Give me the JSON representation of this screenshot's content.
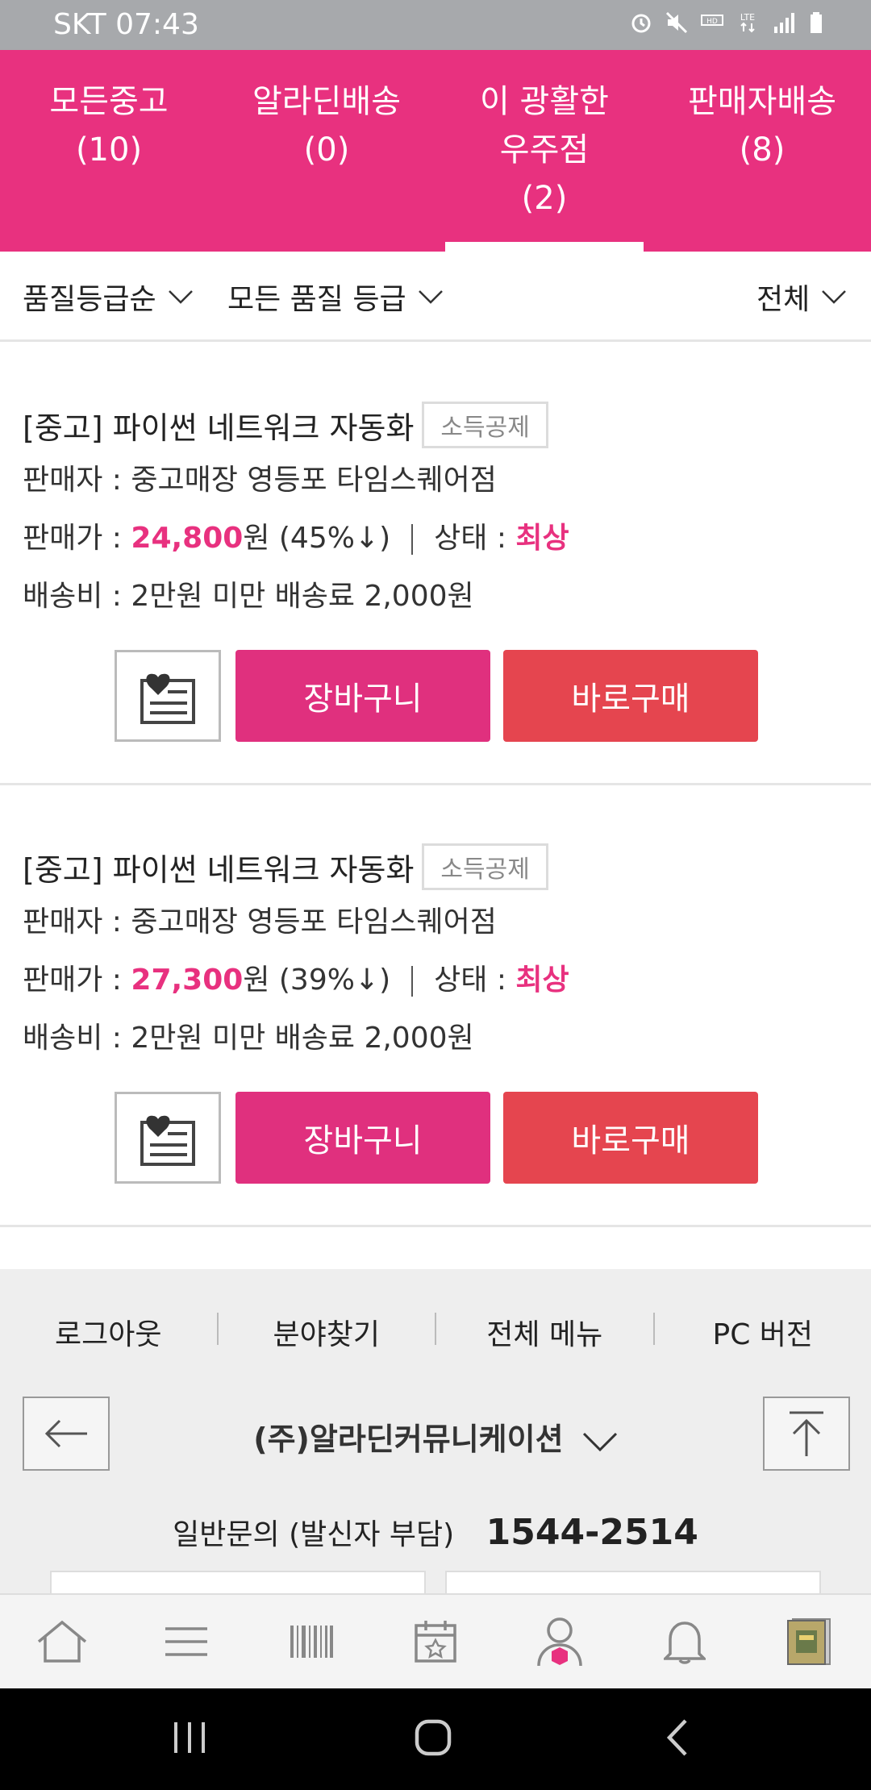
{
  "status_bar": {
    "carrier_time": "SKT 07:43"
  },
  "tabs": [
    {
      "label": "모든중고",
      "count": "(10)"
    },
    {
      "label": "알라딘배송",
      "count": "(0)"
    },
    {
      "label": "이 광활한\n우주점",
      "line1": "이 광활한",
      "line2": "우주점",
      "count": "(2)",
      "active": true
    },
    {
      "label": "판매자배송",
      "count": "(8)"
    }
  ],
  "filters": {
    "sort": "품질등급순",
    "quality": "모든 품질 등급",
    "scope": "전체"
  },
  "products": [
    {
      "title": "[중고] 파이썬 네트워크 자동화",
      "badge": "소득공제",
      "seller_label": "판매자 :",
      "seller": "중고매장 영등포 타임스퀘어점",
      "price_label": "판매가 :",
      "price": "24,800",
      "price_suffix": "원 (45%↓)",
      "condition_label": "상태 :",
      "condition": "최상",
      "shipping": "배송비 : 2만원 미만 배송료 2,000원",
      "cart_label": "장바구니",
      "buy_label": "바로구매"
    },
    {
      "title": "[중고] 파이썬 네트워크 자동화",
      "badge": "소득공제",
      "seller_label": "판매자 :",
      "seller": "중고매장 영등포 타임스퀘어점",
      "price_label": "판매가 :",
      "price": "27,300",
      "price_suffix": "원 (39%↓)",
      "condition_label": "상태 :",
      "condition": "최상",
      "shipping": "배송비 : 2만원 미만 배송료 2,000원",
      "cart_label": "장바구니",
      "buy_label": "바로구매"
    }
  ],
  "footer": {
    "links": [
      "로그아웃",
      "분야찾기",
      "전체 메뉴",
      "PC 버전"
    ],
    "company": "(주)알라딘커뮤니케이션",
    "contact_label": "일반문의 (발신자 부담)",
    "contact_number": "1544-2514"
  },
  "bottom_nav": [
    "home-icon",
    "menu-icon",
    "barcode-icon",
    "calendar-star-icon",
    "my-page-icon",
    "bell-icon",
    "book-thumbnail"
  ],
  "colors": {
    "accent": "#e8317f",
    "buy": "#e5454f",
    "statusbar": "#a7a9ac"
  }
}
